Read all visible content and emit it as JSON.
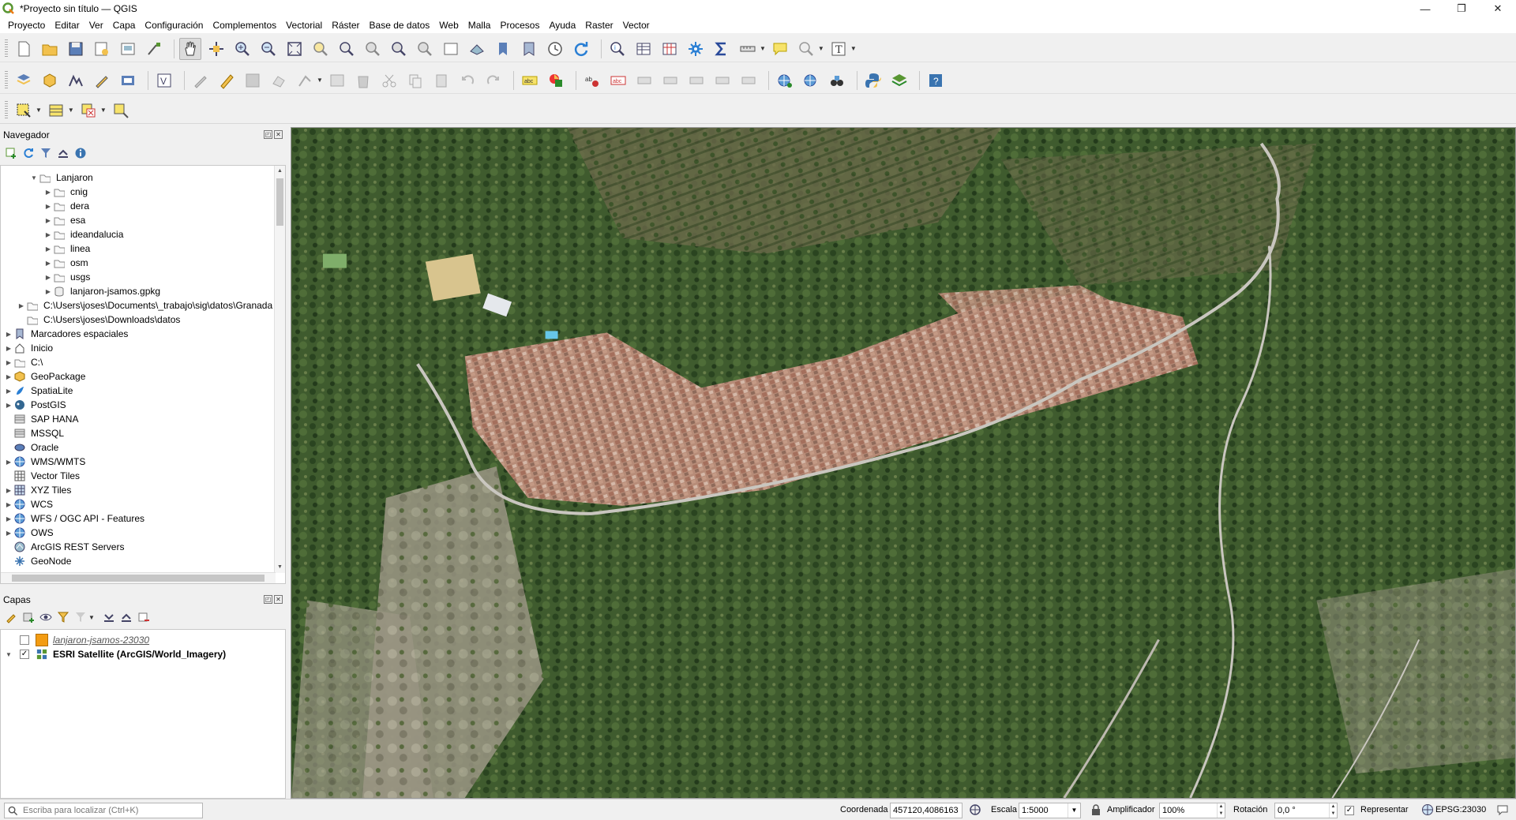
{
  "window": {
    "title": "*Proyecto sin título — QGIS",
    "controls": [
      "—",
      "❐",
      "✕"
    ]
  },
  "menu": [
    "Proyecto",
    "Editar",
    "Ver",
    "Capa",
    "Configuración",
    "Complementos",
    "Vectorial",
    "Ráster",
    "Base de datos",
    "Web",
    "Malla",
    "Procesos",
    "Ayuda",
    "Raster",
    "Vector"
  ],
  "browser": {
    "title": "Navegador",
    "items": [
      {
        "label": "Lanjaron",
        "icon": "folder-open-icon",
        "expanded": true
      },
      {
        "label": "cnig",
        "icon": "folder-icon"
      },
      {
        "label": "dera",
        "icon": "folder-icon"
      },
      {
        "label": "esa",
        "icon": "folder-icon"
      },
      {
        "label": "ideandalucia",
        "icon": "folder-icon"
      },
      {
        "label": "linea",
        "icon": "folder-icon"
      },
      {
        "label": "osm",
        "icon": "folder-icon"
      },
      {
        "label": "usgs",
        "icon": "folder-icon"
      },
      {
        "label": "lanjaron-jsamos.gpkg",
        "icon": "geopackage-file-icon"
      },
      {
        "label": "C:\\Users\\joses\\Documents\\_trabajo\\sig\\datos\\Granada",
        "icon": "folder-icon"
      },
      {
        "label": "C:\\Users\\joses\\Downloads\\datos",
        "icon": "folder-icon"
      },
      {
        "label": "Marcadores espaciales",
        "icon": "bookmarks-icon"
      },
      {
        "label": "Inicio",
        "icon": "home-icon"
      },
      {
        "label": "C:\\",
        "icon": "drive-icon"
      },
      {
        "label": "GeoPackage",
        "icon": "geopackage-icon"
      },
      {
        "label": "SpatiaLite",
        "icon": "spatialite-icon"
      },
      {
        "label": "PostGIS",
        "icon": "postgis-icon"
      },
      {
        "label": "SAP HANA",
        "icon": "sap-hana-icon"
      },
      {
        "label": "MSSQL",
        "icon": "mssql-icon"
      },
      {
        "label": "Oracle",
        "icon": "oracle-icon"
      },
      {
        "label": "WMS/WMTS",
        "icon": "wms-icon"
      },
      {
        "label": "Vector Tiles",
        "icon": "vector-tiles-icon"
      },
      {
        "label": "XYZ Tiles",
        "icon": "xyz-tiles-icon"
      },
      {
        "label": "WCS",
        "icon": "wcs-icon"
      },
      {
        "label": "WFS / OGC API - Features",
        "icon": "wfs-icon"
      },
      {
        "label": "OWS",
        "icon": "ows-icon"
      },
      {
        "label": "ArcGIS REST Servers",
        "icon": "arcgis-icon"
      },
      {
        "label": "GeoNode",
        "icon": "geonode-icon"
      }
    ]
  },
  "layers": {
    "title": "Capas",
    "items": [
      {
        "label": "lanjaron-jsamos-23030",
        "checked": false,
        "color": "#f39c12"
      },
      {
        "label": "ESRI Satellite (ArcGIS/World_Imagery)",
        "checked": true
      }
    ]
  },
  "statusbar": {
    "locator_placeholder": "Escriba para localizar (Ctrl+K)",
    "coordinate_label": "Coordenada",
    "coordinate_value": "457120,4086163",
    "scale_label": "Escala",
    "scale_value": "1:5000",
    "magnifier_label": "Amplificador",
    "magnifier_value": "100%",
    "rotation_label": "Rotación",
    "rotation_value": "0,0 °",
    "render_label": "Representar",
    "crs_label": "EPSG:23030"
  },
  "colors": {
    "accent_green": "#589632",
    "folder": "#fafafa",
    "selected_layer": "#f39c12"
  }
}
